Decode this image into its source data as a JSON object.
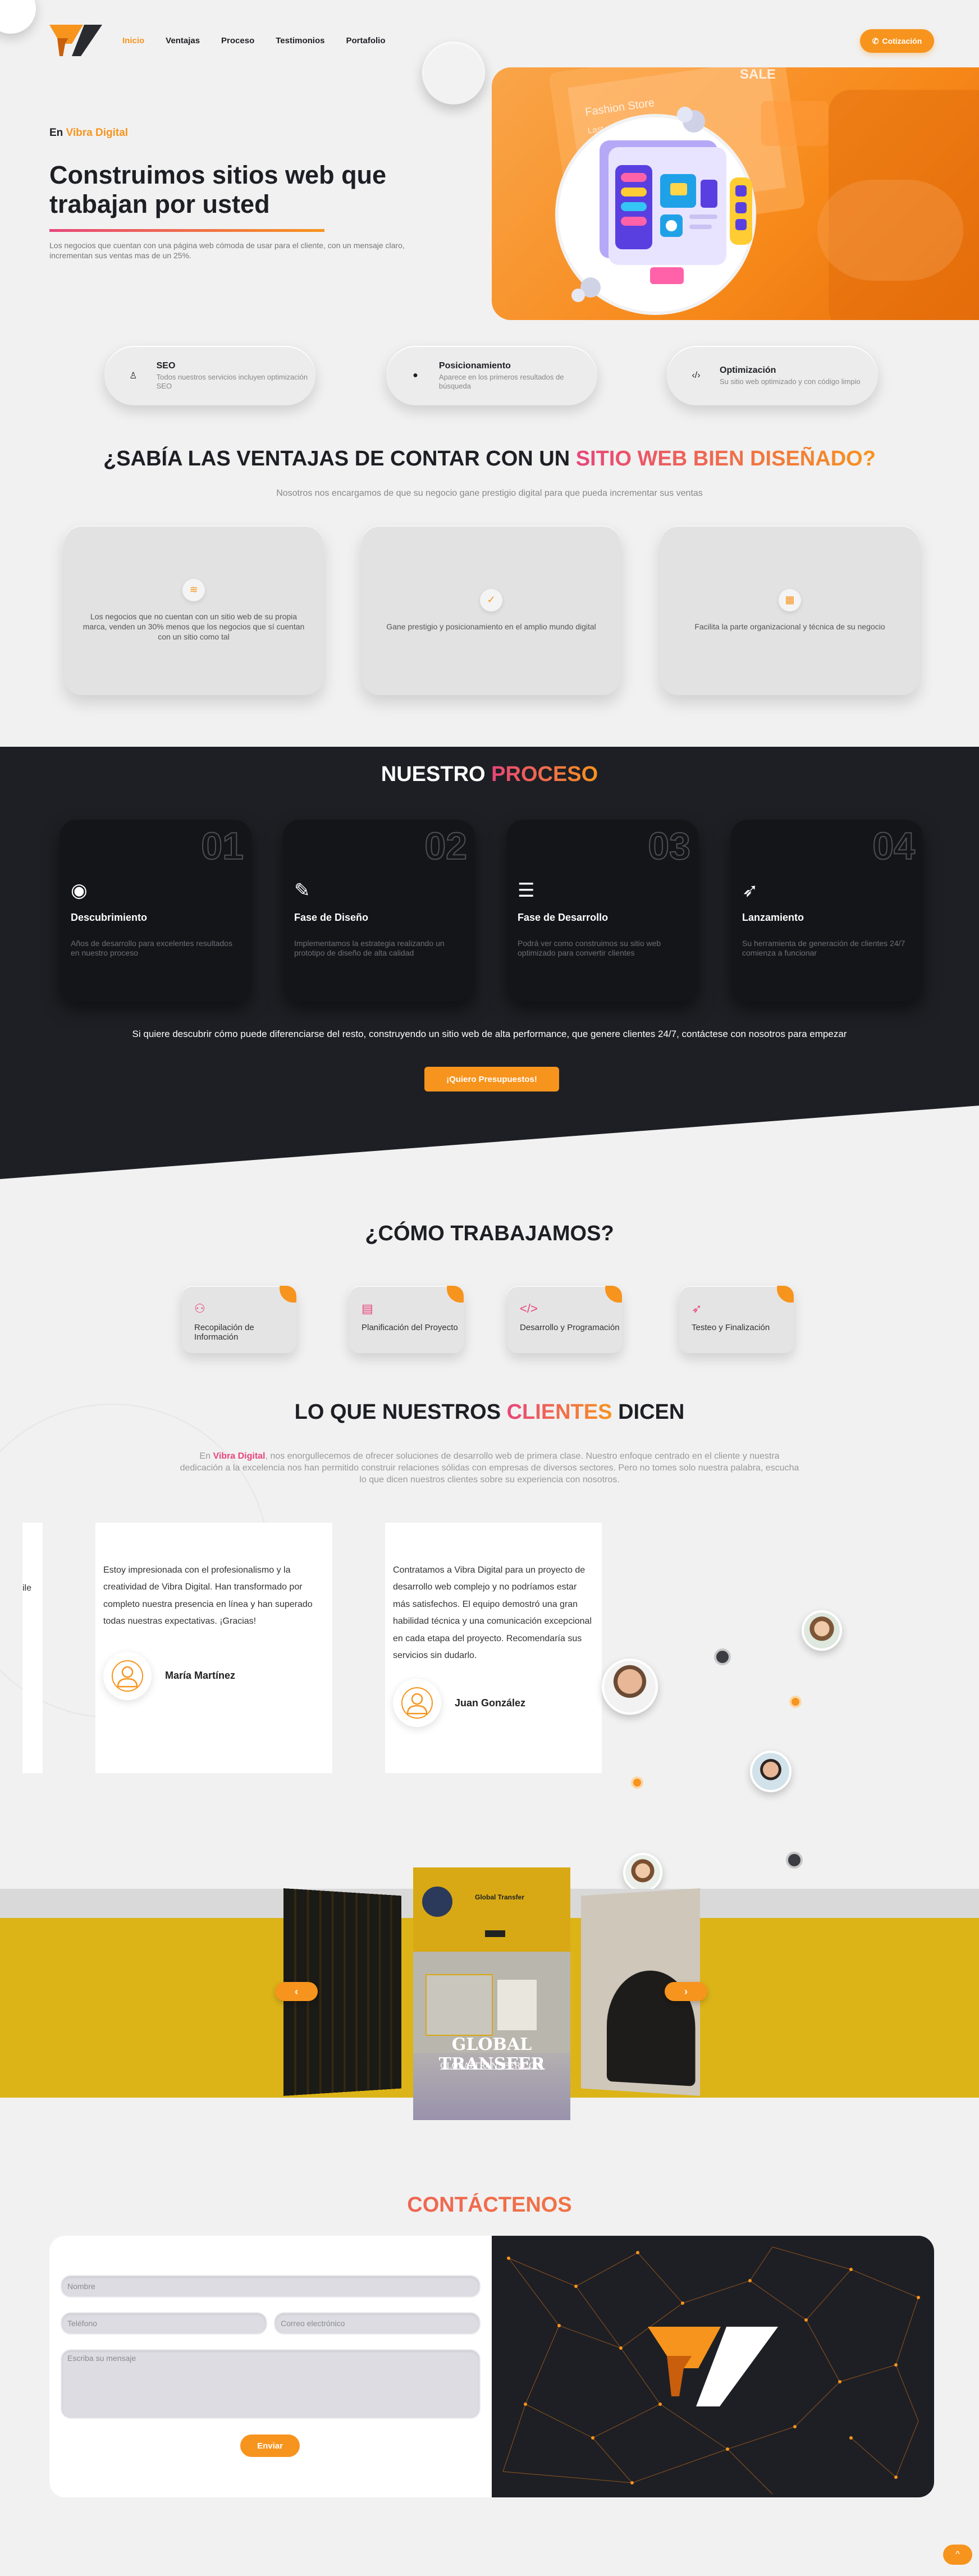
{
  "colors": {
    "accent": "#f7941d",
    "pink": "#e8457a",
    "dark": "#1e1f24",
    "yellow": "#dcb418"
  },
  "header": {
    "nav": [
      {
        "label": "Inicio",
        "active": true
      },
      {
        "label": "Ventajas"
      },
      {
        "label": "Proceso"
      },
      {
        "label": "Testimonios"
      },
      {
        "label": "Portafolio"
      }
    ],
    "cta": {
      "icon": "phone-icon",
      "label": "Cotización"
    }
  },
  "hero": {
    "kicker_prefix": "En",
    "kicker_brand": "Vibra Digital",
    "title": "Construimos sitios web que trabajan por usted",
    "description": "Los negocios que cuentan con una página web cómoda de usar para el cliente, con un mensaje claro, incrementan sus ventas mas de un 25%.",
    "image_texts": {
      "banner": "Fashion Store",
      "sub": "Last week",
      "sale": "SALE"
    }
  },
  "features": [
    {
      "icon": "seo-icon",
      "title": "SEO",
      "text": "Todos nuestros servicios incluyen optimización SEO"
    },
    {
      "icon": "globe-icon",
      "title": "Posicionamiento",
      "text": "Aparece en los primeros resultados de búsqueda"
    },
    {
      "icon": "code-icon",
      "title": "Optimización",
      "text": "Su sitio web optimizado y con código limpio"
    }
  ],
  "ventajas": {
    "title_start": "¿SABÍA LAS VENTAJAS DE CONTAR CON UN",
    "title_highlight": "SITIO WEB BIEN DISEÑADO?",
    "subtitle": "Nosotros nos encargamos de que su negocio gane prestigio digital para que pueda incrementar sus ventas",
    "cards": [
      {
        "icon": "trend-down-icon",
        "text": "Los negocios que no cuentan con un sitio web de su propia marca, venden un 30% menos que los negocios que sí cuentan con un sitio como tal"
      },
      {
        "icon": "badge-check-icon",
        "text": "Gane prestigio y posicionamiento en el amplio mundo digital"
      },
      {
        "icon": "building-icon",
        "text": "Facilita la parte organizacional y técnica de su negocio"
      }
    ]
  },
  "proceso": {
    "title_start": "NUESTRO",
    "title_highlight": "PROCESO",
    "steps": [
      {
        "num": "01",
        "icon": "eye-icon",
        "title": "Descubrimiento",
        "text": "Años de desarrollo para excelentes resultados en nuestro proceso"
      },
      {
        "num": "02",
        "icon": "edit-icon",
        "title": "Fase de Diseño",
        "text": "Implementamos la estrategia realizando un prototipo de diseño de alta calidad"
      },
      {
        "num": "03",
        "icon": "layers-icon",
        "title": "Fase de Desarrollo",
        "text": "Podrá ver como construimos su sitio web optimizado para convertir clientes"
      },
      {
        "num": "04",
        "icon": "rocket-icon",
        "title": "Lanzamiento",
        "text": "Su herramienta de generación de clientes 24/7 comienza a funcionar"
      }
    ],
    "note": "Si quiere descubrir cómo puede diferenciarse del resto, construyendo un sitio web de alta performance, que genere clientes 24/7, contáctese con nosotros para empezar",
    "cta": "¡Quiero Presupuestos!"
  },
  "como": {
    "title": "¿CÓMO TRABAJAMOS?",
    "items": [
      {
        "icon": "sitemap-icon",
        "label": "Recopilación de Información"
      },
      {
        "icon": "calendar-icon",
        "label": "Planificación del Proyecto"
      },
      {
        "icon": "code-icon",
        "label": "Desarrollo y Programación"
      },
      {
        "icon": "rocket-icon",
        "label": "Testeo y Finalización"
      }
    ]
  },
  "testimonios": {
    "title_start": "LO QUE NUESTROS",
    "title_highlight": "CLIENTES",
    "title_end": "DICEN",
    "desc_brand": "Vibra Digital",
    "desc_prefix": "En",
    "desc": ", nos enorgullecemos de ofrecer soluciones de desarrollo web de primera clase. Nuestro enfoque centrado en el cliente y nuestra dedicación a la excelencia nos han permitido construir relaciones sólidas con empresas de diversos sectores. Pero no tomes solo nuestra palabra, escucha lo que dicen nuestros clientes sobre su experiencia con nosotros.",
    "partial_left": "ile",
    "items": [
      {
        "quote": "Estoy impresionada con el profesionalismo y la creatividad de Vibra Digital. Han transformado por completo nuestra presencia en línea y han superado todas nuestras expectativas. ¡Gracias!",
        "name": "María Martínez"
      },
      {
        "quote": "Contratamos a Vibra Digital para un proyecto de desarrollo web complejo y no podríamos estar más satisfechos. El equipo demostró una gran habilidad técnica y una comunicación excepcional en cada etapa del proyecto. Recomendaría sus servicios sin dudarlo.",
        "name": "Juan González"
      }
    ]
  },
  "portafolio": {
    "project_title": "GLOBAL TRANSFER",
    "project_link": "GLOBALTRANSFER.COM",
    "site_heading": "Global Transfer",
    "prev": "‹",
    "next": "›"
  },
  "contacto": {
    "title": "CONTÁCTENOS",
    "fields": {
      "nombre": "Nombre",
      "telefono": "Teléfono",
      "correo": "Correo electrónico",
      "mensaje": "Escriba su mensaje"
    },
    "submit": "Enviar"
  },
  "fab": {
    "icon": "chevron-up-icon",
    "label": "^"
  }
}
